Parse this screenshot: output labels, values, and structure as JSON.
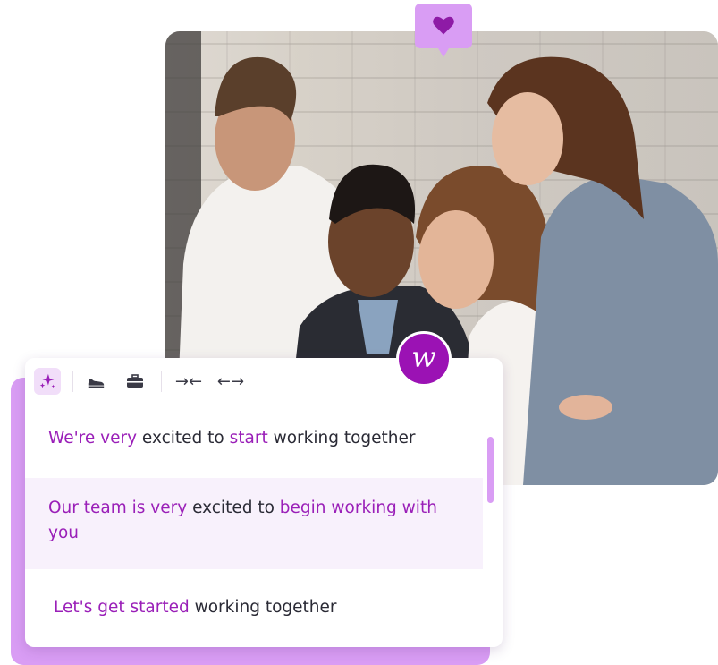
{
  "photo": {
    "alt_subject": "team-photo"
  },
  "badge": {
    "icon": "heart-icon",
    "color": "#d99df4"
  },
  "toolbar": {
    "buttons": [
      {
        "name": "sparkle-icon",
        "active": true
      },
      {
        "name": "shoe-icon",
        "active": false
      },
      {
        "name": "briefcase-icon",
        "active": false
      },
      {
        "name": "shorten-icon",
        "glyph": "→←"
      },
      {
        "name": "expand-icon",
        "glyph": "←→"
      }
    ]
  },
  "suggestions": [
    {
      "parts": [
        {
          "text": "We're very",
          "highlight": true
        },
        {
          "text": " excited to ",
          "highlight": false
        },
        {
          "text": "start",
          "highlight": true
        },
        {
          "text": " working together",
          "highlight": false
        }
      ]
    },
    {
      "selected": true,
      "parts": [
        {
          "text": "Our team is very",
          "highlight": true
        },
        {
          "text": " excited to ",
          "highlight": false
        },
        {
          "text": "begin working with you",
          "highlight": true
        }
      ]
    },
    {
      "parts": [
        {
          "text": "Let's get started",
          "highlight": true
        },
        {
          "text": " working together",
          "highlight": false
        }
      ]
    }
  ],
  "logo": {
    "letter": "w"
  },
  "colors": {
    "accent": "#9a1fb8",
    "light_accent": "#d99df4",
    "selected_bg": "#f8f1fc"
  }
}
